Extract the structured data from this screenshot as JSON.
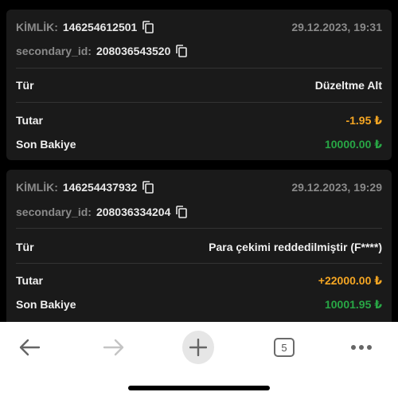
{
  "transactions": [
    {
      "id_label": "KİMLİK:",
      "id_value": "146254612501",
      "date": "29.12.2023, 19:31",
      "secondary_label": "secondary_id:",
      "secondary_value": "208036543520",
      "type_label": "Tür",
      "type_value": "Düzeltme Alt",
      "amount_label": "Tutar",
      "amount_value": "-1.95 ₺",
      "balance_label": "Son Bakiye",
      "balance_value": "10000.00 ₺"
    },
    {
      "id_label": "KİMLİK:",
      "id_value": "146254437932",
      "date": "29.12.2023, 19:29",
      "secondary_label": "secondary_id:",
      "secondary_value": "208036334204",
      "type_label": "Tür",
      "type_value": "Para çekimi reddedilmiştir (F****)",
      "amount_label": "Tutar",
      "amount_value": "+22000.00 ₺",
      "balance_label": "Son Bakiye",
      "balance_value": "10001.95 ₺"
    }
  ],
  "toolbar": {
    "tab_count": "5",
    "icons": [
      "back-arrow-icon",
      "forward-arrow-icon",
      "plus-icon",
      "tabs-icon",
      "more-icon"
    ]
  },
  "colors": {
    "amount": "#f5a623",
    "balance": "#28a745",
    "card_bg": "#1a1a1a"
  }
}
